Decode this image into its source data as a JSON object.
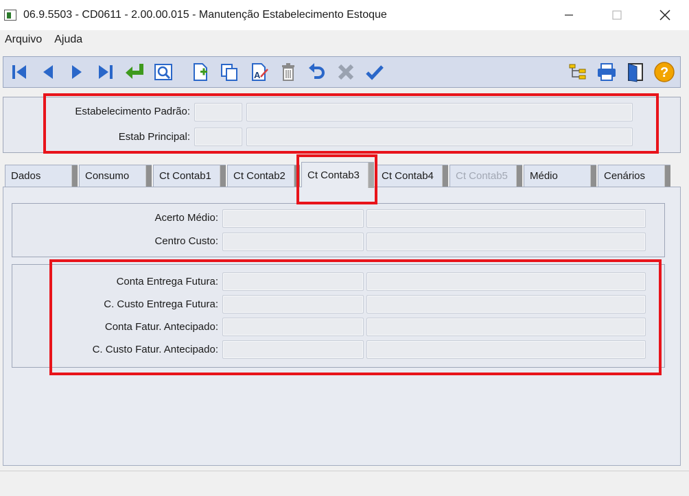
{
  "window": {
    "title": "06.9.5503 - CD0611 - 2.00.00.015 - Manutenção Estabelecimento Estoque"
  },
  "menu": {
    "items": [
      "Arquivo",
      "Ajuda"
    ]
  },
  "toolbar": {
    "buttons": [
      {
        "name": "first-record",
        "icon": "first-icon"
      },
      {
        "name": "previous-record",
        "icon": "previous-icon"
      },
      {
        "name": "next-record",
        "icon": "next-icon"
      },
      {
        "name": "last-record",
        "icon": "last-icon"
      },
      {
        "name": "goto-record",
        "icon": "goto-arrow-icon"
      },
      {
        "name": "search",
        "icon": "magnifier-icon"
      },
      {
        "name": "new-record",
        "icon": "new-document-icon"
      },
      {
        "name": "copy-record",
        "icon": "copy-icon"
      },
      {
        "name": "edit-record",
        "icon": "edit-icon"
      },
      {
        "name": "delete-record",
        "icon": "trash-icon"
      },
      {
        "name": "undo",
        "icon": "undo-icon"
      },
      {
        "name": "cancel",
        "icon": "cancel-x-icon"
      },
      {
        "name": "confirm",
        "icon": "checkmark-icon"
      },
      {
        "name": "tree",
        "icon": "tree-icon"
      },
      {
        "name": "print",
        "icon": "printer-icon"
      },
      {
        "name": "exit",
        "icon": "exit-door-icon"
      },
      {
        "name": "help",
        "icon": "help-icon"
      }
    ],
    "colors": {
      "blue": "#2a67c9",
      "green": "#3e9a1e",
      "gray": "#8a8a8a",
      "yellow": "#f2a400"
    }
  },
  "header": {
    "estab_padrao_label": "Estabelecimento Padrão:",
    "estab_padrao_code": "",
    "estab_padrao_desc": "",
    "estab_principal_label": "Estab Principal:",
    "estab_principal_code": "",
    "estab_principal_desc": ""
  },
  "tabs": [
    {
      "label": "Dados",
      "state": "normal"
    },
    {
      "label": "Consumo",
      "state": "normal"
    },
    {
      "label": "Ct Contab1",
      "state": "normal"
    },
    {
      "label": "Ct Contab2",
      "state": "normal"
    },
    {
      "label": "Ct Contab3",
      "state": "active"
    },
    {
      "label": "Ct Contab4",
      "state": "normal"
    },
    {
      "label": "Ct Contab5",
      "state": "disabled"
    },
    {
      "label": "Médio",
      "state": "normal"
    },
    {
      "label": "Cenários",
      "state": "normal"
    }
  ],
  "ct_contab3": {
    "group1": {
      "acerto_medio_label": "Acerto Médio:",
      "acerto_medio_code": "",
      "acerto_medio_desc": "",
      "centro_custo_label": "Centro Custo:",
      "centro_custo_code": "",
      "centro_custo_desc": ""
    },
    "group2": {
      "conta_entrega_futura_label": "Conta Entrega Futura:",
      "conta_entrega_futura_code": "",
      "conta_entrega_futura_desc": "",
      "ccusto_entrega_futura_label": "C. Custo Entrega Futura:",
      "ccusto_entrega_futura_code": "",
      "ccusto_entrega_futura_desc": "",
      "conta_fatur_antecipado_label": "Conta Fatur. Antecipado:",
      "conta_fatur_antecipado_code": "",
      "conta_fatur_antecipado_desc": "",
      "ccusto_fatur_antecipado_label": "C. Custo Fatur. Antecipado:",
      "ccusto_fatur_antecipado_code": "",
      "ccusto_fatur_antecipado_desc": ""
    }
  },
  "highlight_color": "#e8141b"
}
